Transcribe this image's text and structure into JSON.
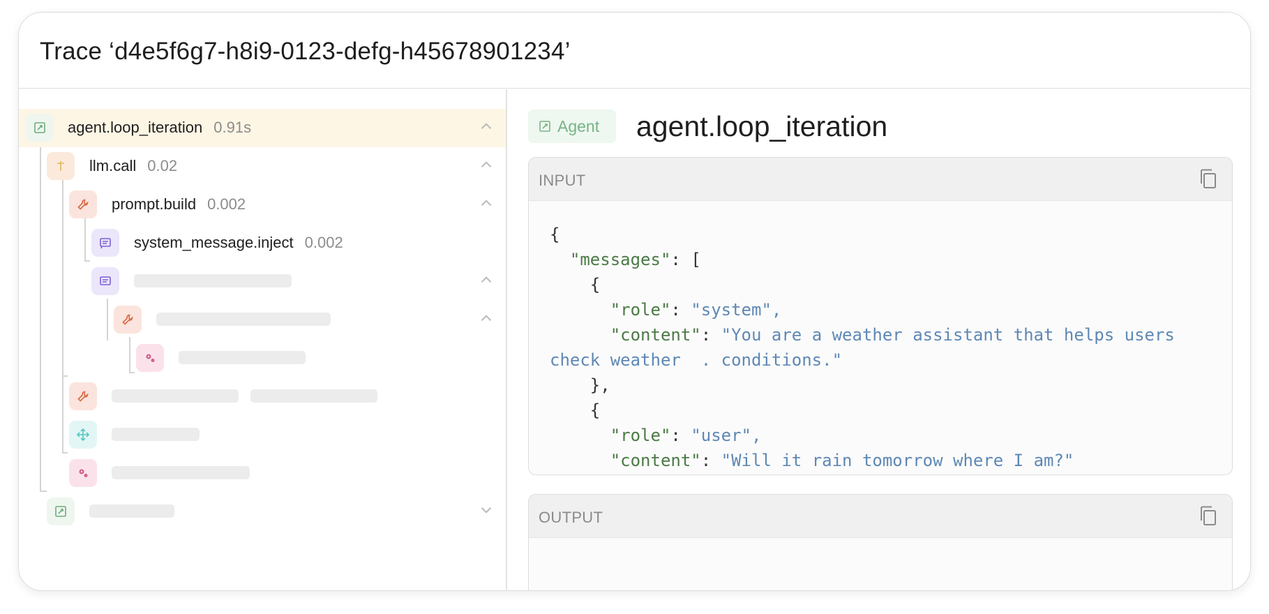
{
  "trace": {
    "title": "Trace ‘d4e5f6g7-h8i9-0123-defg-h45678901234’"
  },
  "tree": {
    "rows": [
      {
        "label": "agent.loop_iteration",
        "duration": "0.91s",
        "icon": "agent-icon",
        "selected": true
      },
      {
        "label": "llm.call",
        "duration": "0.02",
        "icon": "llm-icon"
      },
      {
        "label": "prompt.build",
        "duration": "0.002",
        "icon": "wrench-icon"
      },
      {
        "label": "system_message.inject",
        "duration": "0.002",
        "icon": "message-icon"
      }
    ]
  },
  "detail": {
    "badge": "Agent",
    "title": "agent.loop_iteration",
    "input_label": "INPUT",
    "output_label": "OUTPUT",
    "input_json": {
      "open": "{",
      "messages_key": "\"messages\"",
      "open_bracket": "[",
      "msg1_role_key": "\"role\"",
      "msg1_role_val": "\"system\",",
      "msg1_content_key": "\"content\"",
      "msg1_content_val": "\"You are a weather assistant that helps users check weather  . conditions.\"",
      "msg2_role_key": "\"role\"",
      "msg2_role_val": "\"user\",",
      "msg2_content_key": "\"content\"",
      "msg2_content_val": "\"Will it rain tomorrow where I am?\"",
      "close_bracket": "],"
    }
  },
  "colors": {
    "selected_row": "#fdf6e4",
    "agent": "#6fab7d",
    "llm": "#e6b45a",
    "tool": "#d96c48",
    "message": "#7a5ed6",
    "cog": "#d2628f",
    "json_key": "#4c7a46",
    "json_string": "#5f88b4"
  }
}
